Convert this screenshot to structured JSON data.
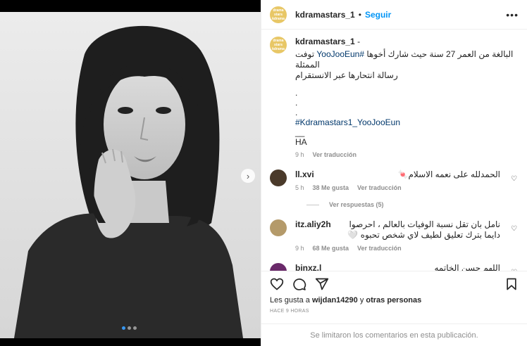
{
  "post": {
    "username": "kdramastars_1",
    "separator": "•",
    "follow_label": "Seguir",
    "more_label": "•••",
    "avatar_text": "drama stars kdrama"
  },
  "caption": {
    "username": "kdramastars_1",
    "dash": "-",
    "text_prefix": "البالغة من العمر 27 سنة حيث شارك أخوها ",
    "text_tag": "#YooJooEun",
    "text_suffix": " توفت الممثلة",
    "line2": "رسالة انتحارها عبر الانستقرام",
    "dots": [
      ".",
      ".",
      "."
    ],
    "hashtag": "#Kdramastars1_YooJooEun",
    "underscore": "__",
    "signature": "HA",
    "time": "9 h",
    "translate": "Ver traducción"
  },
  "comments": [
    {
      "username": "ll.xvi",
      "text": "الحمدلله على نعمه الاسلام🍬",
      "time": "5 h",
      "likes": "38 Me gusta",
      "translate": "Ver traducción",
      "avatar_color": "#4a3a2a"
    },
    {
      "username": "itz.aliy2h",
      "text": "نامل بان تقل نسبة الوفيات بالعالم ، احرصوا دايما بترك تعليق لطيف لاي شخص تحبوه 🤍",
      "time": "9 h",
      "likes": "68 Me gusta",
      "translate": "Ver traducción",
      "avatar_color": "#b49a6a"
    },
    {
      "username": "binxz.l",
      "text": "اللهم حسن الخاتمه",
      "avatar_color": "#6a2a6a"
    }
  ],
  "replies_label": "Ver respuestas (5)",
  "likes": {
    "prefix": "Les gusta a",
    "user": "wijdan14290",
    "conj": "y",
    "others": "otras personas"
  },
  "posted_ago": "HACE 9 HORAS",
  "limited_comments": "Se limitaron los comentarios en esta publicación.",
  "colors": {
    "accent": "#0095f6",
    "carousel_active_dot": "#3897f0",
    "hashtag": "#00376b",
    "muted": "#8e8e8e"
  },
  "icons": [
    "heart-icon",
    "comment-icon",
    "share-icon",
    "bookmark-icon",
    "chevron-right-icon"
  ]
}
